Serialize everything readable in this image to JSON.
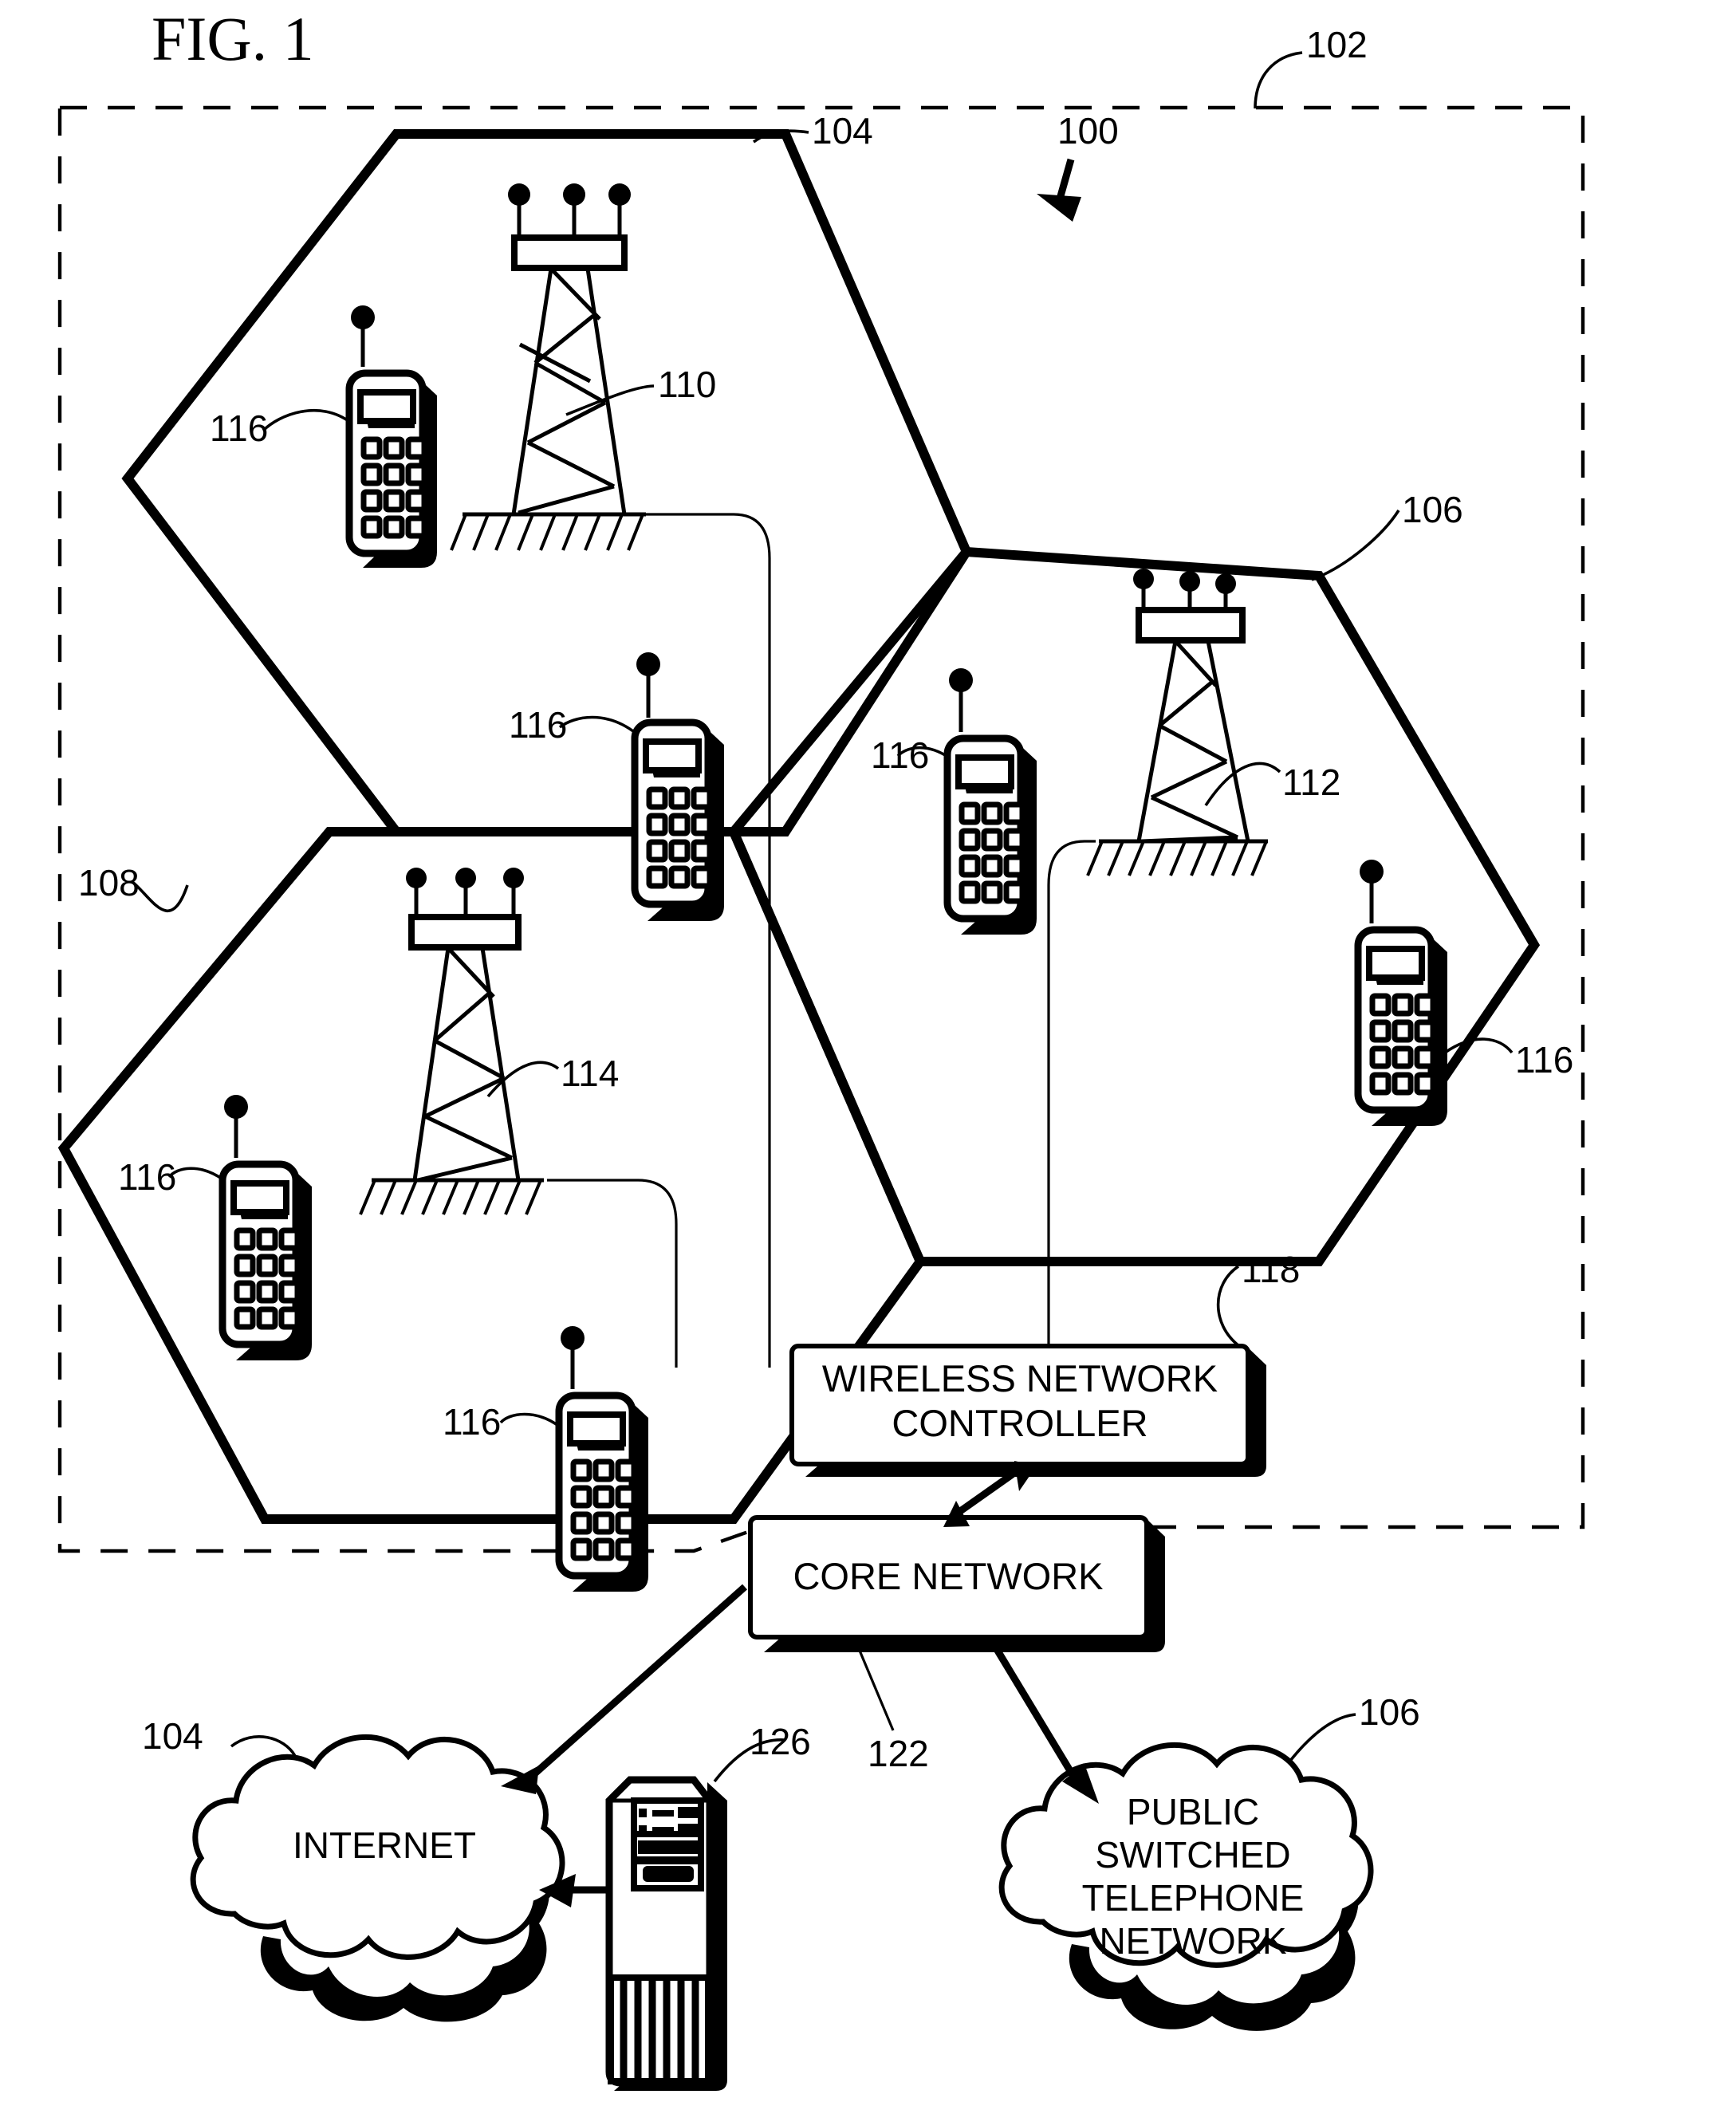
{
  "figure": {
    "title": "FIG. 1",
    "domain_type": "patent-diagram"
  },
  "reference_numerals": {
    "system": "100",
    "radio_access_network_boundary": "102",
    "cell_top": "104",
    "cell_right": "106",
    "cell_left": "108",
    "base_station_top": "110",
    "base_station_right": "112",
    "base_station_left": "114",
    "mobile_station_top_left": "116",
    "mobile_station_top_right": "116",
    "mobile_station_mid_left": "116",
    "mobile_station_right_edge": "116",
    "mobile_station_bottom_left": "116",
    "mobile_station_bottom_mid": "116",
    "backhaul_link": "118",
    "core_link": "122",
    "server_node": "126",
    "internet_cloud": "104",
    "pstn_cloud": "106"
  },
  "blocks": {
    "wireless_network_controller": {
      "line1": "WIRELESS NETWORK",
      "line2": "CONTROLLER"
    },
    "core_network": {
      "line1": "CORE NETWORK"
    }
  },
  "clouds": {
    "internet": {
      "lines": [
        "INTERNET"
      ]
    },
    "pstn": {
      "lines": [
        "PUBLIC",
        "SWITCHED",
        "TELEPHONE",
        "NETWORK"
      ]
    }
  },
  "colors": {
    "ink": "#000000",
    "paper": "#ffffff"
  }
}
